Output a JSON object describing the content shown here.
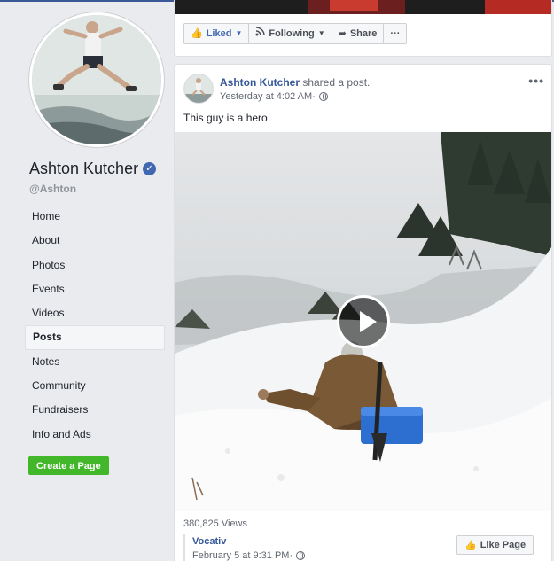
{
  "page": {
    "name": "Ashton Kutcher",
    "handle": "@Ashton",
    "verified": true
  },
  "sidebar": {
    "items": [
      {
        "label": "Home",
        "active": false
      },
      {
        "label": "About",
        "active": false
      },
      {
        "label": "Photos",
        "active": false
      },
      {
        "label": "Events",
        "active": false
      },
      {
        "label": "Videos",
        "active": false
      },
      {
        "label": "Posts",
        "active": true
      },
      {
        "label": "Notes",
        "active": false
      },
      {
        "label": "Community",
        "active": false
      },
      {
        "label": "Fundraisers",
        "active": false
      },
      {
        "label": "Info and Ads",
        "active": false
      }
    ],
    "create_page_label": "Create a Page"
  },
  "action_bar": {
    "liked_label": "Liked",
    "following_label": "Following",
    "share_label": "Share",
    "more_label": "···"
  },
  "post": {
    "author": "Ashton Kutcher",
    "action_text": " shared a post.",
    "timestamp": "Yesterday at 4:02 AM",
    "separator": " · ",
    "more_label": "•••",
    "text": "This guy is a hero.",
    "views": "380,825 Views",
    "shared_from": {
      "name": "Vocativ",
      "timestamp": "February 5 at 9:31 PM",
      "separator": " · "
    },
    "like_page_label": "Like Page"
  },
  "icons": {
    "liked": "thumbs-up-icon",
    "following": "rss-icon",
    "share": "share-arrow-icon",
    "globe": "globe-icon",
    "verified": "verified-check-icon",
    "play": "play-icon"
  },
  "colors": {
    "brand": "#4267b2",
    "link": "#365899",
    "create_button": "#42b72a",
    "background": "#e9ebee"
  }
}
